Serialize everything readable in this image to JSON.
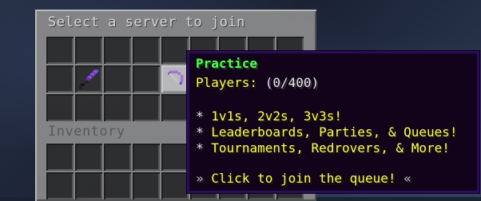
{
  "gui": {
    "title": "Select a server to join",
    "inventory_label": "Inventory",
    "colors": {
      "panel": "#8c8c8c",
      "slot": "#2f2f2f",
      "tooltip_bg": "#12021a",
      "tooltip_border": "#2c0a5c"
    }
  },
  "slots": {
    "sword_icon": "netherite-sword-icon",
    "bow_icon": "bow-icon"
  },
  "tooltip": {
    "title": "Practice",
    "players_label": "Players:",
    "players_count": "(0/400)",
    "bullet": "*",
    "lines": [
      "1v1s, 2v2s, 3v3s!",
      "Leaderboards, Parties, & Queues!",
      "Tournaments, Redrovers, & More!"
    ],
    "cta_open": "»",
    "cta_text": "Click to join the queue!",
    "cta_close": "«",
    "colors": {
      "title": "#55ff55",
      "text": "#ffff55",
      "muted": "#e8e8e8"
    }
  }
}
